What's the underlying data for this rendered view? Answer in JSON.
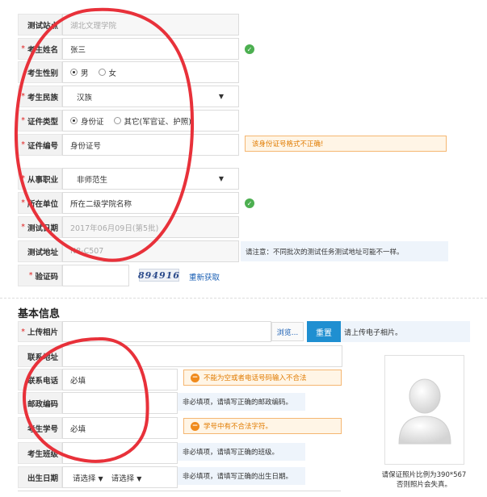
{
  "form": {
    "test_site": {
      "label": "测试站点",
      "value": "湖北文理学院"
    },
    "name": {
      "label": "考生姓名",
      "value": "张三"
    },
    "gender": {
      "label": "考生性别",
      "options": [
        "男",
        "女"
      ],
      "selected": "男"
    },
    "ethnicity": {
      "label": "考生民族",
      "value": "汉族"
    },
    "id_type": {
      "label": "证件类型",
      "options": [
        "身份证",
        "其它(军官证、护照)"
      ],
      "selected": "身份证"
    },
    "id_number": {
      "label": "证件编号",
      "value": "身份证号",
      "error": "该身份证号格式不正确!"
    },
    "occupation": {
      "label": "从事职业",
      "value": "非师范生"
    },
    "workplace": {
      "label": "所在单位",
      "value": "所在二级学院名称"
    },
    "test_date": {
      "label": "测试日期",
      "value": "2017年06月09日(第5批)"
    },
    "test_address": {
      "label": "测试地址",
      "value": "N8-C507",
      "note": "请注意：不同批次的测试任务测试地址可能不一样。"
    },
    "captcha": {
      "label": "验证码",
      "image_text": "894916",
      "refresh_label": "重新获取"
    }
  },
  "basic_info": {
    "title": "基本信息",
    "photo": {
      "label": "上传相片",
      "browse_label": "浏览...",
      "upload_label": "重置",
      "hint": "请上传电子相片。"
    },
    "contact_address": {
      "label": "联系地址",
      "value": ""
    },
    "phone": {
      "label": "联系电话",
      "value": "必填",
      "error": "不能为空或者电话号码输入不合法"
    },
    "postcode": {
      "label": "邮政编码",
      "value": "",
      "note": "非必填项，请填写正确的邮政编码。"
    },
    "student_id": {
      "label": "考生学号",
      "value": "必填",
      "error": "学号中有不合法字符。"
    },
    "class": {
      "label": "考生班级",
      "value": "",
      "note": "非必填项，请填写正确的班级。"
    },
    "birth_date": {
      "label": "出生日期",
      "year_placeholder": "请选择",
      "month_placeholder": "请选择",
      "note": "非必填项，请填写正确的出生日期。"
    },
    "photo_caption_line1": "请保证照片比例为390*567",
    "photo_caption_line2": "否则照片会失真。"
  },
  "colors": {
    "required": "#e02020",
    "ok": "#4caf50",
    "warn": "#f08a1c",
    "annotation": "#e8313a",
    "button": "#1f8fd1"
  }
}
